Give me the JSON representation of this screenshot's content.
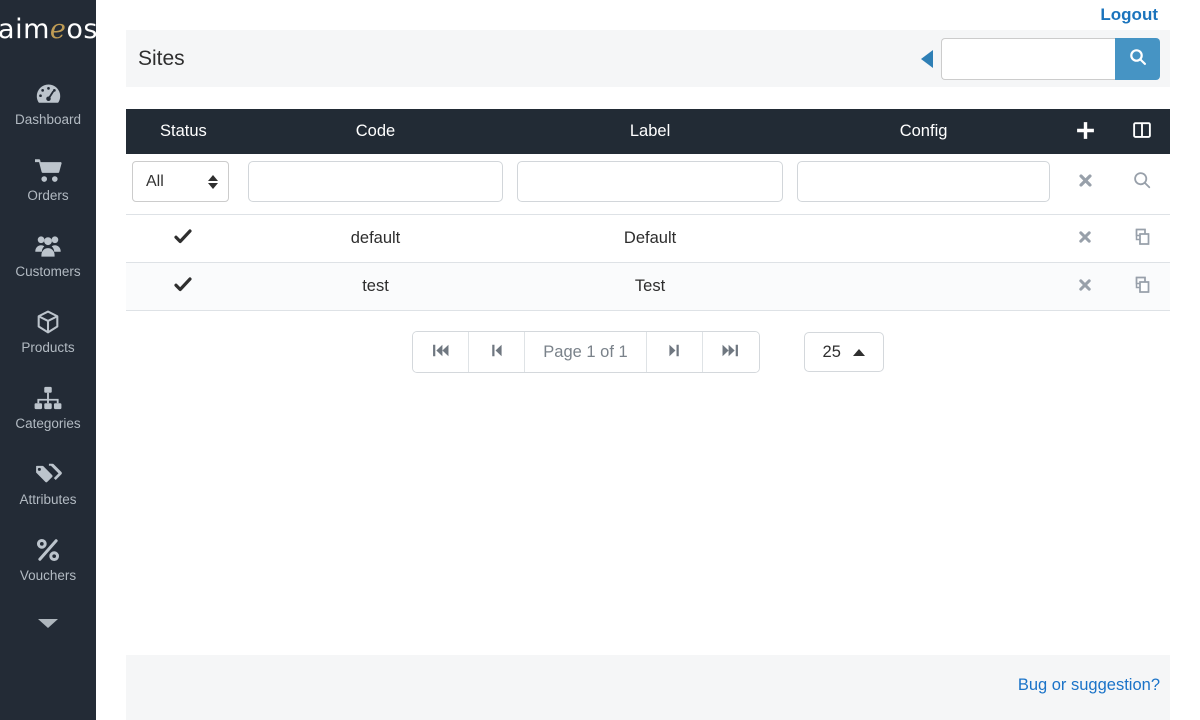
{
  "app": {
    "logo_pre": "aim",
    "logo_accent": "e",
    "logo_post": "os"
  },
  "topbar": {
    "logout_label": "Logout"
  },
  "sidebar": {
    "items": [
      {
        "label": "Dashboard",
        "icon": "dashboard-icon"
      },
      {
        "label": "Orders",
        "icon": "cart-icon"
      },
      {
        "label": "Customers",
        "icon": "users-icon"
      },
      {
        "label": "Products",
        "icon": "cube-icon"
      },
      {
        "label": "Categories",
        "icon": "sitemap-icon"
      },
      {
        "label": "Attributes",
        "icon": "tags-icon"
      },
      {
        "label": "Vouchers",
        "icon": "percent-icon"
      }
    ]
  },
  "header": {
    "title": "Sites",
    "search_value": "",
    "search_placeholder": ""
  },
  "table": {
    "columns": {
      "status": "Status",
      "code": "Code",
      "label": "Label",
      "config": "Config"
    },
    "filter": {
      "status_selected": "All",
      "code_value": "",
      "label_value": "",
      "config_value": ""
    },
    "rows": [
      {
        "status": "enabled",
        "code": "default",
        "label": "Default",
        "config": ""
      },
      {
        "status": "enabled",
        "code": "test",
        "label": "Test",
        "config": ""
      }
    ]
  },
  "pagination": {
    "page_text": "Page 1 of 1",
    "limit": "25"
  },
  "footer": {
    "link_label": "Bug or suggestion?"
  },
  "colors": {
    "sidebar_bg": "#232b36",
    "table_header_bg": "#222b35",
    "logo_accent": "#bf9c55",
    "logout_blue": "#1b74bd",
    "search_button_blue": "#4694c4",
    "footer_link_blue": "#1a73c8",
    "icon_gray": "#98a0aa",
    "pagination_icon_gray": "#6f7780"
  }
}
